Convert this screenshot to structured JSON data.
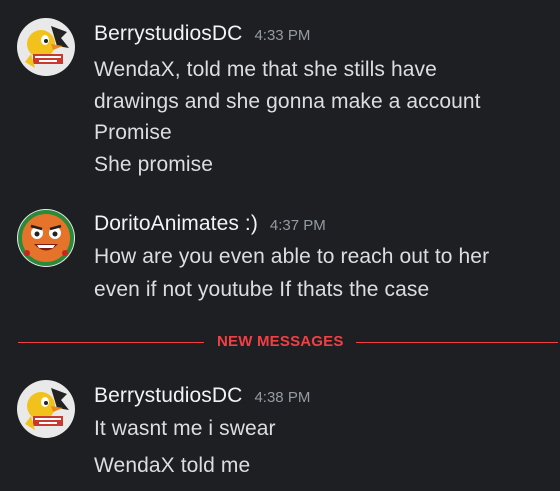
{
  "messages": [
    {
      "username": "BerrystudiosDC",
      "timestamp": "4:33 PM",
      "avatar_icon": "duck-character-avatar",
      "lines": [
        "WendaX, told me that she stills have",
        "drawings and she gonna make a account",
        "Promise",
        "She promise"
      ]
    },
    {
      "username": "DoritoAnimates :)",
      "timestamp": "4:37 PM",
      "avatar_icon": "dorito-character-avatar",
      "lines": [
        "How are you even able to reach out to her",
        "even if not youtube If thats the case"
      ]
    },
    {
      "username": "BerrystudiosDC",
      "timestamp": "4:38 PM",
      "avatar_icon": "duck-character-avatar",
      "lines": [
        "It wasnt me i swear",
        "WendaX told me"
      ]
    }
  ],
  "divider": {
    "label": "NEW MESSAGES",
    "color": "#f23f43"
  },
  "colors": {
    "background": "#1e1f22",
    "username": "#f2f3f5",
    "text": "#dbdee1",
    "timestamp": "#949ba4"
  }
}
